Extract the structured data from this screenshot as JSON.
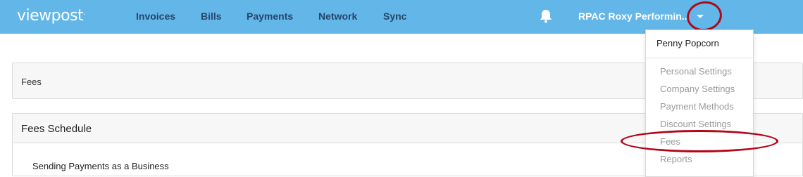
{
  "header": {
    "logo": "viewpost",
    "nav": [
      "Invoices",
      "Bills",
      "Payments",
      "Network",
      "Sync"
    ],
    "company": "RPAC Roxy Performin...",
    "bell_icon": "bell-icon",
    "caret_icon": "caret-down-icon",
    "bg_color": "#62b6e8",
    "nav_color": "#27466a"
  },
  "main": {
    "fees_panel_title": "Fees",
    "schedule_title": "Fees Schedule",
    "schedule_subtitle": "Sending Payments as a Business"
  },
  "dropdown": {
    "user": "Penny Popcorn",
    "items": [
      "Personal Settings",
      "Company Settings",
      "Payment Methods",
      "Discount Settings",
      "Fees",
      "Reports"
    ]
  },
  "annotation_color": "#b0081a"
}
